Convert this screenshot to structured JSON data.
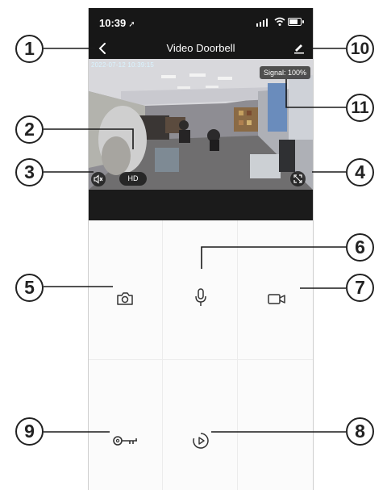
{
  "status_bar": {
    "time": "10:39"
  },
  "header": {
    "title": "Video Doorbell"
  },
  "video": {
    "timestamp": "2022-07-12  10:39:15",
    "signal": "Signal: 100%",
    "quality_label": "HD"
  },
  "icons": {
    "back": "back-chevron-icon",
    "edit": "pencil-icon",
    "mute": "speaker-muted-icon",
    "fullscreen": "fullscreen-icon",
    "snapshot": "camera-icon",
    "talk": "microphone-icon",
    "record": "video-camera-icon",
    "unlock": "key-icon",
    "playback": "play-circle-icon"
  },
  "callouts": [
    "1",
    "2",
    "3",
    "4",
    "5",
    "6",
    "7",
    "8",
    "9",
    "10",
    "11"
  ],
  "colors": {
    "accent": "#222222",
    "bar": "#171717"
  }
}
